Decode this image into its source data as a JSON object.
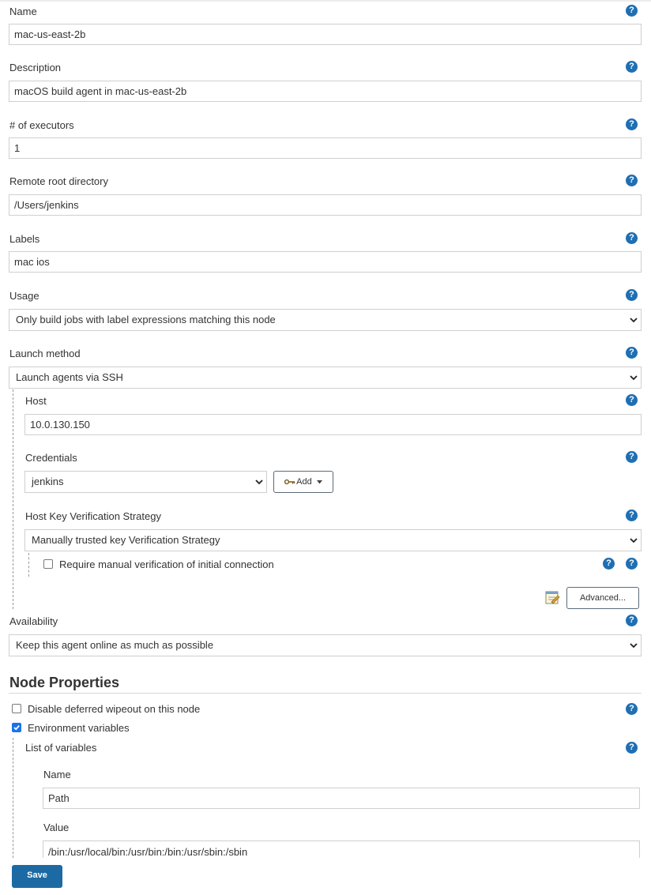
{
  "fields": {
    "name": {
      "label": "Name",
      "value": "mac-us-east-2b"
    },
    "description": {
      "label": "Description",
      "value": "macOS build agent in mac-us-east-2b"
    },
    "executors": {
      "label": "# of executors",
      "value": "1"
    },
    "remote_root": {
      "label": "Remote root directory",
      "value": "/Users/jenkins"
    },
    "labels": {
      "label": "Labels",
      "value": "mac ios"
    },
    "usage": {
      "label": "Usage",
      "value": "Only build jobs with label expressions matching this node"
    },
    "launch_method": {
      "label": "Launch method",
      "value": "Launch agents via SSH"
    }
  },
  "ssh": {
    "host": {
      "label": "Host",
      "value": "10.0.130.150"
    },
    "credentials": {
      "label": "Credentials",
      "value": "jenkins",
      "add_label": "Add"
    },
    "host_key": {
      "label": "Host Key Verification Strategy",
      "value": "Manually trusted key Verification Strategy"
    },
    "require_manual": {
      "label": "Require manual verification of initial connection",
      "checked": false
    },
    "advanced_label": "Advanced..."
  },
  "availability": {
    "label": "Availability",
    "value": "Keep this agent online as much as possible"
  },
  "node_properties": {
    "title": "Node Properties",
    "disable_wipeout": {
      "label": "Disable deferred wipeout on this node",
      "checked": false
    },
    "env_vars": {
      "label": "Environment variables",
      "checked": true
    },
    "list_label": "List of variables",
    "var_name": {
      "label": "Name",
      "value": "Path"
    },
    "var_value": {
      "label": "Value",
      "value": "/bin:/usr/local/bin:/usr/bin:/bin:/usr/sbin:/sbin"
    }
  },
  "save_label": "Save",
  "help_glyph": "?",
  "colors": {
    "help": "#1f6fb2",
    "save": "#1c6aa3",
    "checkbox_checked": "#1a73e8"
  }
}
